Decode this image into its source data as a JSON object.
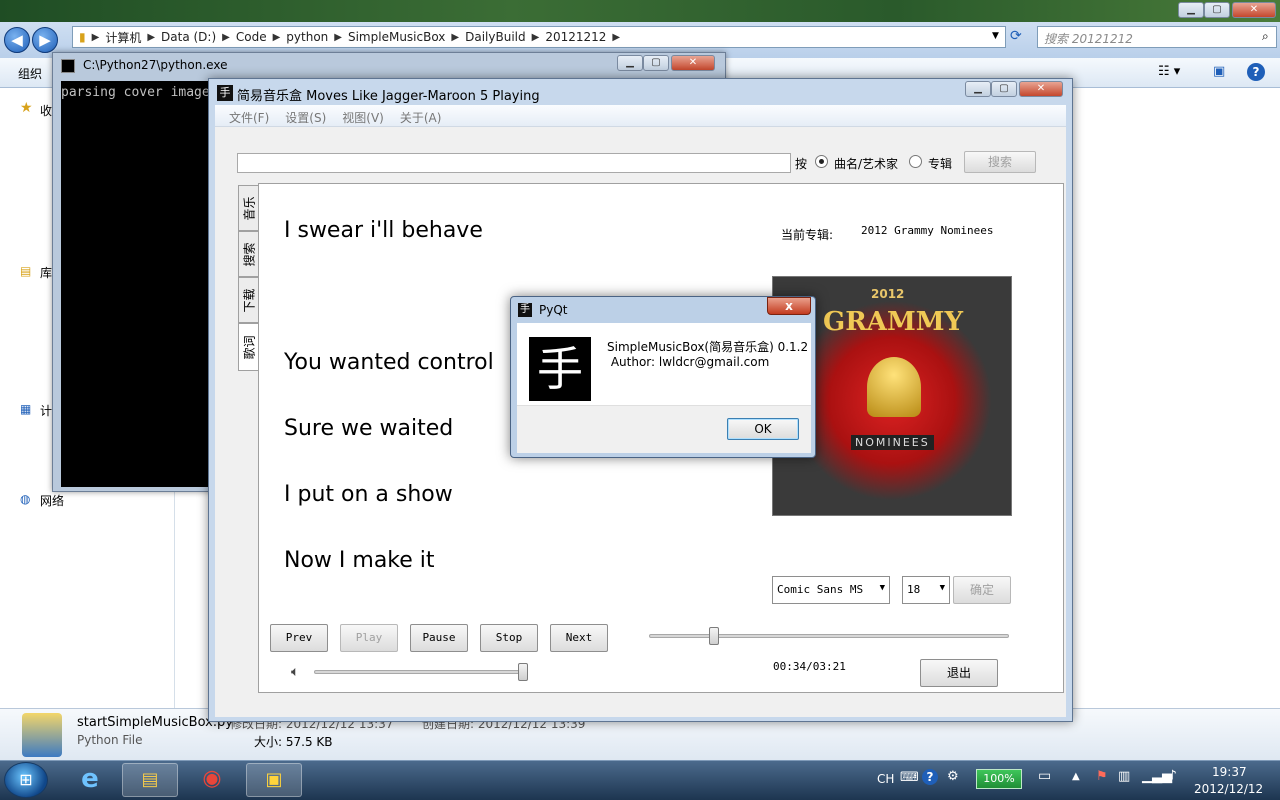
{
  "explorer": {
    "nav": {
      "back": "◀",
      "forward": "▶"
    },
    "breadcrumbs": [
      "计算机",
      "Data (D:)",
      "Code",
      "python",
      "SimpleMusicBox",
      "DailyBuild",
      "20121212"
    ],
    "search_placeholder": "搜索 20121212",
    "organize_label": "组织",
    "left_labels": [
      "收",
      "库",
      "计",
      "网络"
    ],
    "details": {
      "filename": "startSimpleMusicBox.py",
      "modified": "修改日期: 2012/12/12 13:37",
      "created": "创建日期: 2012/12/12 13:39",
      "type": "Python File",
      "size": "大小: 57.5 KB"
    }
  },
  "console": {
    "title": "C:\\Python27\\python.exe",
    "output": "parsing cover image"
  },
  "app": {
    "title": "简易音乐盒 Moves Like Jagger-Maroon 5 Playing",
    "menu": [
      "文件(F)",
      "设置(S)",
      "视图(V)",
      "关于(A)"
    ],
    "search_by_label": "按",
    "radio_song_artist": "曲名/艺术家",
    "radio_album": "专辑",
    "search_button": "搜索",
    "tabs": [
      "音乐",
      "搜索",
      "下载",
      "歌词"
    ],
    "lyrics": [
      "I swear i'll behave",
      "You wanted control",
      "Sure we waited",
      "I put on a show",
      "Now I make it"
    ],
    "current_album_label": "当前专辑:",
    "current_album_value": "2012 Grammy Nominees",
    "cover_text_top": "2012",
    "cover_text_main": "GRAMMY",
    "cover_text_bottom": "NOMINEES",
    "font_combo": "Comic Sans MS",
    "size_combo": "18",
    "confirm_button": "确定",
    "controls": {
      "prev": "Prev",
      "play": "Play",
      "pause": "Pause",
      "stop": "Stop",
      "next": "Next"
    },
    "time": "00:34/03:21",
    "progress_fraction": 0.17,
    "volume_fraction": 1.0,
    "exit_button": "退出"
  },
  "dialog": {
    "title": "PyQt",
    "close": "x",
    "line1": "SimpleMusicBox(简易音乐盒) 0.1.2",
    "line2": " Author: lwldcr@gmail.com",
    "ok": "OK"
  },
  "taskbar": {
    "lang": "CH",
    "battery": "100%",
    "time": "19:37",
    "date": "2012/12/12"
  },
  "colors": {
    "accent": "#1f5fb8",
    "taskbar": "#1d3550",
    "dialog_frame": "#bcd0e7"
  }
}
